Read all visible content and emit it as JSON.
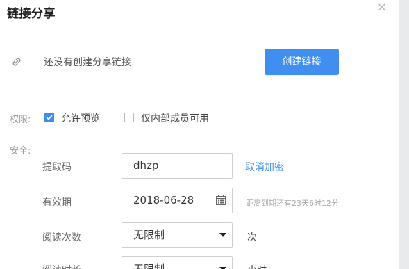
{
  "dialog": {
    "title": "链接分享",
    "close_icon": "close-icon"
  },
  "link_status": {
    "icon": "link-icon",
    "empty_text": "还没有创建分享链接",
    "create_button_label": "创建链接"
  },
  "permission": {
    "label": "权限:",
    "allow_preview_label": "允许预览",
    "allow_preview_checked": true,
    "internal_only_label": "仅内部成员可用",
    "internal_only_checked": false
  },
  "security": {
    "label": "安全:",
    "extraction_code_label": "提取码",
    "extraction_code_value": "dhzp",
    "cancel_encryption_label": "取消加密",
    "validity_label": "有效期",
    "validity_value": "2018-06-28",
    "validity_hint": "距离到期还有23天6时12分",
    "read_count_label": "阅读次数",
    "read_count_value": "无限制",
    "read_count_unit": "次",
    "read_duration_label": "阅读时长",
    "read_duration_value": "无限制",
    "read_duration_unit": "小时"
  },
  "colors": {
    "accent": "#3f8ef0",
    "muted_text": "#999999",
    "border": "#cfcfcf"
  }
}
